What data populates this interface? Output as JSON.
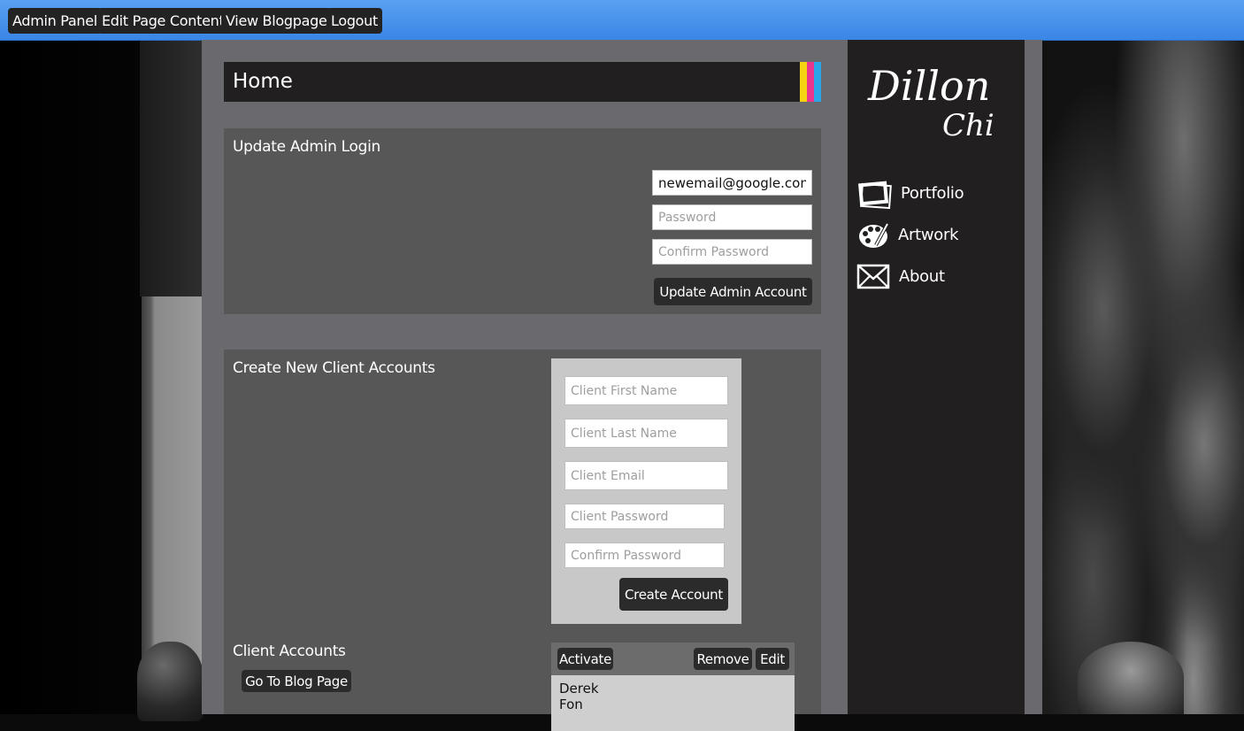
{
  "topbar": {
    "buttons": [
      "Admin Panel",
      "Edit Page Content",
      "View Blogpage",
      "Logout"
    ]
  },
  "main": {
    "title": "Home",
    "accent_colors": [
      "#f5d313",
      "#e8358d",
      "#2aa5e8"
    ],
    "admin_login": {
      "heading": "Update Admin Login",
      "email_value": "newemail@google.com",
      "password_placeholder": "Password",
      "confirm_placeholder": "Confirm Password",
      "submit_label": "Update Admin Account"
    },
    "create_accounts": {
      "heading": "Create New Client Accounts",
      "first_name_placeholder": "Client First Name",
      "last_name_placeholder": "Client Last Name",
      "email_placeholder": "Client Email",
      "password_placeholder": "Client Password",
      "confirm_placeholder": "Confirm Password",
      "submit_label": "Create Account"
    },
    "client_accounts": {
      "heading": "Client Accounts",
      "blog_button": "Go To Blog Page",
      "activate_label": "Activate",
      "remove_label": "Remove",
      "edit_label": "Edit",
      "clients": [
        {
          "first": "Derek",
          "last": "Fon"
        }
      ]
    }
  },
  "sidebar": {
    "logo_text": [
      "Dillon",
      "Chi"
    ],
    "nav": [
      {
        "label": "Portfolio",
        "icon": "photos-icon"
      },
      {
        "label": "Artwork",
        "icon": "palette-icon"
      },
      {
        "label": "About",
        "icon": "envelope-icon"
      }
    ]
  }
}
